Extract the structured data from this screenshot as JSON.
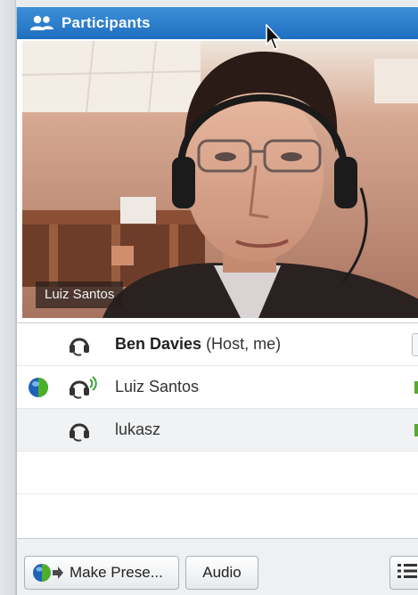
{
  "panel": {
    "title": "Participants",
    "accent": "#2a7bcc"
  },
  "video": {
    "label": "Luiz Santos"
  },
  "participants": [
    {
      "name": "Ben Davies",
      "role": " (Host, me)",
      "status": "none",
      "audio": "headset-icon"
    },
    {
      "name": "Luiz Santos",
      "role": "",
      "status": "active",
      "audio": "headset-speaking-icon"
    },
    {
      "name": "lukasz",
      "role": "",
      "status": "none",
      "audio": "headset-icon"
    }
  ],
  "toolbar": {
    "present_label": "Make Prese...",
    "audio_label": "Audio"
  }
}
